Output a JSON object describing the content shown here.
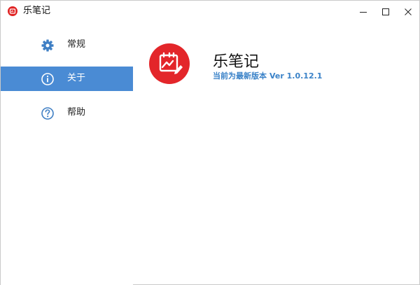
{
  "window": {
    "title": "乐笔记",
    "buttons": {
      "minimize": "minimize",
      "maximize": "maximize",
      "close": "close"
    }
  },
  "sidebar": {
    "items": [
      {
        "label": "常规",
        "icon": "gear-icon",
        "active": false
      },
      {
        "label": "关于",
        "icon": "info-icon",
        "active": true
      },
      {
        "label": "帮助",
        "icon": "help-icon",
        "active": false
      }
    ]
  },
  "about": {
    "app_name": "乐笔记",
    "version_prefix": "当前为最新版本",
    "version": "Ver 1.0.12.1"
  },
  "colors": {
    "accent": "#4a8bd4",
    "brand_red": "#e3262a",
    "version_text": "#3a82c8"
  }
}
